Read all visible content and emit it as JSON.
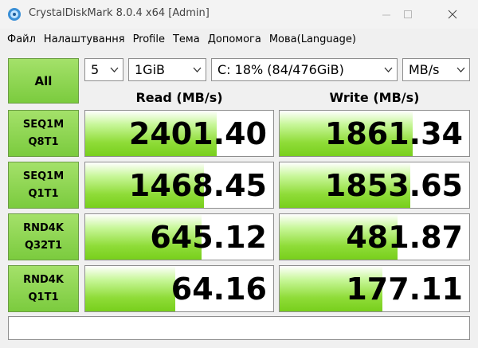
{
  "window": {
    "title": "CrystalDiskMark 8.0.4 x64 [Admin]"
  },
  "menu": [
    "Файл",
    "Налаштування",
    "Profile",
    "Тема",
    "Допомога",
    "Мова(Language)"
  ],
  "controls": {
    "all_label": "All",
    "count": "5",
    "size": "1GiB",
    "drive": "C: 18% (84/476GiB)",
    "unit": "MB/s"
  },
  "headers": {
    "read": "Read (MB/s)",
    "write": "Write (MB/s)"
  },
  "rows": [
    {
      "line1": "SEQ1M",
      "line2": "Q8T1",
      "read": "2401.40",
      "write": "1861.34",
      "read_fill": 0.7,
      "write_fill": 0.7
    },
    {
      "line1": "SEQ1M",
      "line2": "Q1T1",
      "read": "1468.45",
      "write": "1853.65",
      "read_fill": 0.63,
      "write_fill": 0.69
    },
    {
      "line1": "RND4K",
      "line2": "Q32T1",
      "read": "645.12",
      "write": "481.87",
      "read_fill": 0.62,
      "write_fill": 0.62
    },
    {
      "line1": "RND4K",
      "line2": "Q1T1",
      "read": "64.16",
      "write": "177.11",
      "read_fill": 0.48,
      "write_fill": 0.54
    }
  ],
  "comment": "",
  "colors": {
    "accent_green": "#7bcb3e",
    "bar_green": "#8fdc38"
  }
}
